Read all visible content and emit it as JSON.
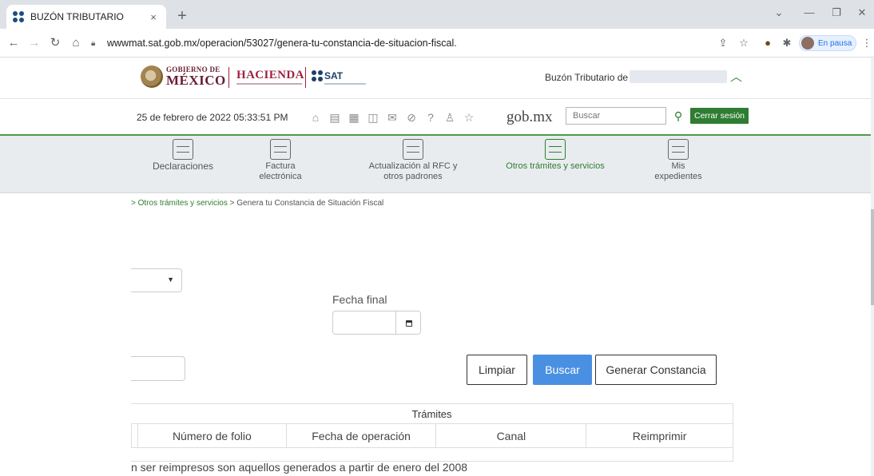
{
  "browser": {
    "tab_title": "BUZÓN TRIBUTARIO",
    "tab_close": "×",
    "new_tab": "+",
    "url": "wwwmat.sat.gob.mx/operacion/53027/genera-tu-constancia-de-situacion-fiscal.",
    "profile_label": "En pausa"
  },
  "header": {
    "gob_small": "GOBIERNO DE",
    "gob_big": "MÉXICO",
    "hacienda": "HACIENDA",
    "sat": "SAT",
    "buzon_label": "Buzón Tributario de",
    "expand_icon": "chevron-up-icon"
  },
  "topbar": {
    "datetime": "25 de febrero de 2022 05:33:51 PM",
    "gobmx": "gob.mx",
    "search_placeholder": "Buscar",
    "logout_label": "Cerrar sesión"
  },
  "menu": {
    "items": [
      {
        "label": "Declaraciones",
        "icon": "declaraciones-icon"
      },
      {
        "label": "Factura electrónica",
        "icon": "factura-icon"
      },
      {
        "label": "Actualización al RFC y otros padrones",
        "icon": "rfc-icon"
      },
      {
        "label": "Otros trámites y servicios",
        "icon": "otros-tramites-icon",
        "active": true
      },
      {
        "label": "Mis expedientes",
        "icon": "expedientes-icon"
      }
    ]
  },
  "breadcrumb": {
    "link": "> Otros trámites y servicios",
    "current": "> Genera tu Constancia de Situación Fiscal"
  },
  "form": {
    "fecha_final_label": "Fecha final",
    "buttons": {
      "limpiar": "Limpiar",
      "buscar": "Buscar",
      "generar": "Generar Constancia"
    }
  },
  "table": {
    "caption": "Trámites",
    "columns": [
      "Número de folio",
      "Fecha de operación",
      "Canal",
      "Reimprimir"
    ]
  },
  "note": "n ser reimpresos son aquellos generados a partir de enero del 2008",
  "colors": {
    "primary_blue": "#4a90e2",
    "sat_green": "#2e7d32",
    "gob_maroon": "#691c32"
  }
}
